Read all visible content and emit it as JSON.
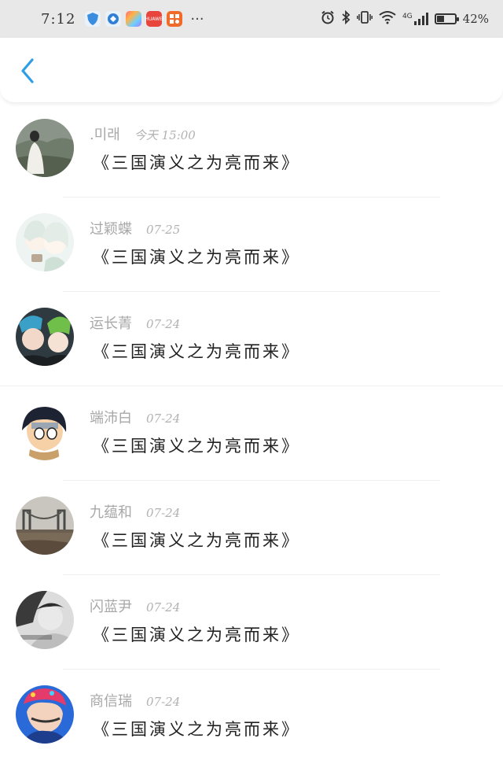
{
  "status_bar": {
    "time": "7:12",
    "network": "4G",
    "battery": "42%",
    "battery_level": 0.42,
    "app_icons": [
      "shield-app-icon",
      "browser-app-icon",
      "gallery-app-icon",
      "huawei-app-icon",
      "store-app-icon"
    ],
    "more": "···"
  },
  "nav": {
    "back_icon": "chevron-left-icon",
    "accent": "#2f9ee5"
  },
  "messages": [
    {
      "name": ".미래",
      "date": "今天 15:00",
      "text": "《三国演义之为亮而来》",
      "avatar": "landscape-photo"
    },
    {
      "name": "过颖蝶",
      "date": "07-25",
      "text": "《三国演义之为亮而来》",
      "avatar": "anime-girls"
    },
    {
      "name": "运长菁",
      "date": "07-24",
      "text": "《三国演义之为亮而来》",
      "avatar": "couple-photo"
    },
    {
      "name": "端沛白",
      "date": "07-24",
      "text": "《三国演义之为亮而来》",
      "avatar": "naruto-character"
    },
    {
      "name": "九蕴和",
      "date": "07-24",
      "text": "《三国演义之为亮而来》",
      "avatar": "bridge-photo"
    },
    {
      "name": "闪蓝尹",
      "date": "07-24",
      "text": "《三国演义之为亮而来》",
      "avatar": "bw-photo"
    },
    {
      "name": "商信瑞",
      "date": "07-24",
      "text": "《三国演义之为亮而来》",
      "avatar": "girl-with-hat"
    }
  ]
}
